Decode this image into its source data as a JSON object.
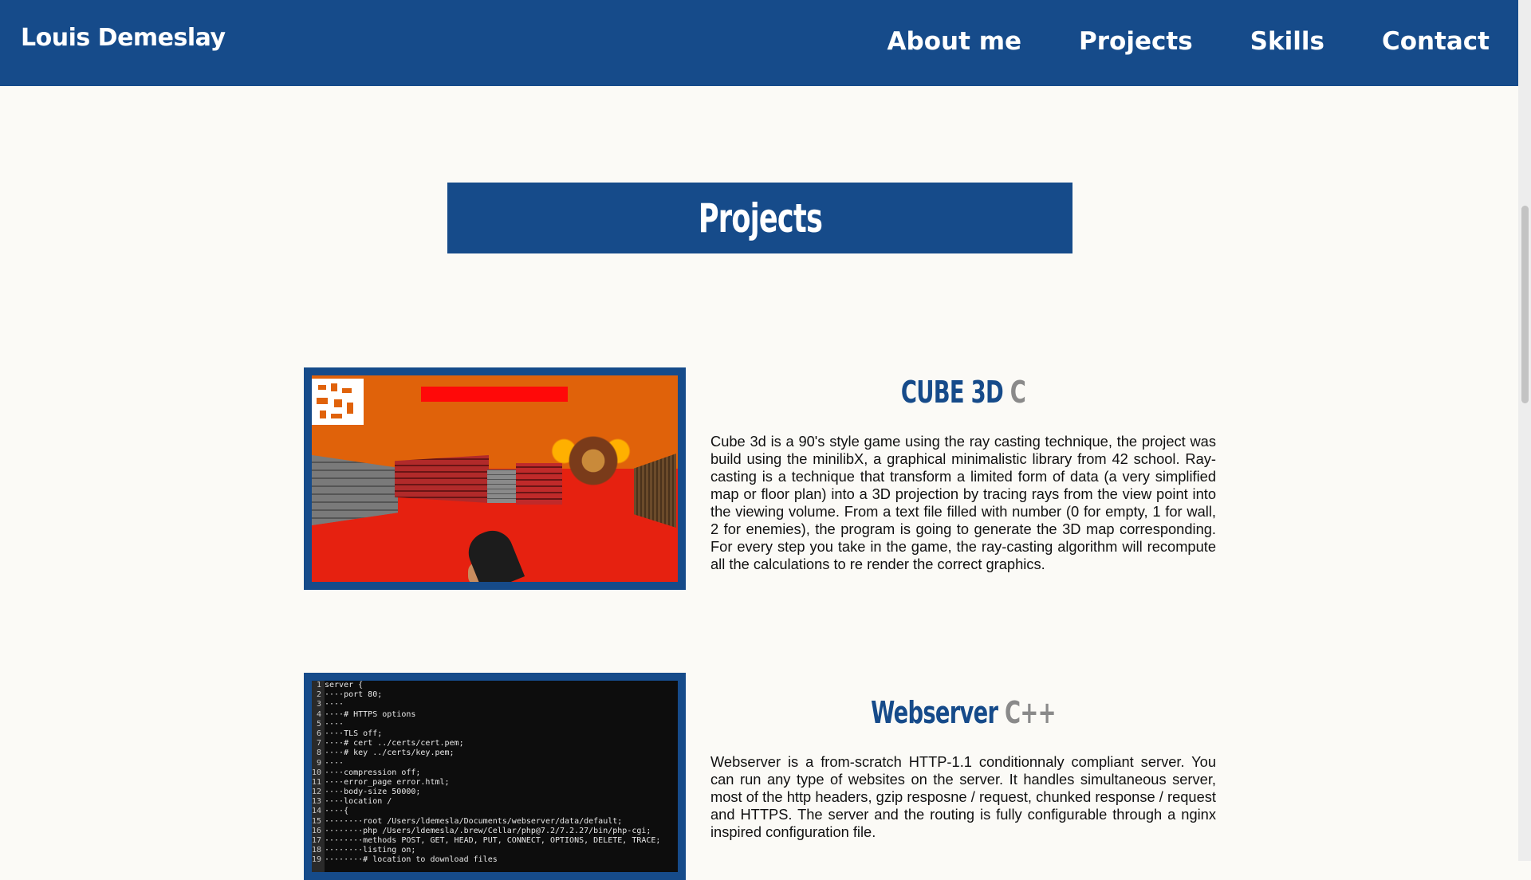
{
  "navbar": {
    "brand": "Louis Demeslay",
    "links": [
      "About me",
      "Projects",
      "Skills",
      "Contact"
    ]
  },
  "section": {
    "title": "Projects"
  },
  "projects": [
    {
      "name": "CUBE 3D",
      "lang": "C",
      "description": "Cube 3d is a 90's style game using the ray casting technique, the project was build using the minilibX, a graphical minimalistic library from 42 school. Ray-casting is a technique that transform a limited form of data (a very simplified map or floor plan) into a 3D projection by tracing rays from the view point into the viewing volume. From a text file filled with number (0 for empty, 1 for wall, 2 for enemies), the program is going to generate the 3D map corresponding. For every step you take in the game, the ray-casting algorithm will recompute all the calculations to re render the correct graphics."
    },
    {
      "name": "Webserver",
      "lang": "C++",
      "description": "Webserver is a from-scratch HTTP-1.1 conditionnaly compliant server. You can run any type of websites on the server. It handles simultaneous server, most of the http headers, gzip resposne / request, chunked response / request and HTTPS. The server and the routing is fully configurable through a nginx inspired configuration file."
    }
  ],
  "code_lines": [
    "server {",
    "····port 80;",
    "····",
    "····# HTTPS options",
    "····",
    "····TLS off;",
    "····# cert ../certs/cert.pem;",
    "····# key ../certs/key.pem;",
    "····",
    "····compression off;",
    "····error_page error.html;",
    "····body-size 50000;",
    "····location /",
    "····{",
    "········root /Users/ldemesla/Documents/webserver/data/default;",
    "········php /Users/ldemesla/.brew/Cellar/php@7.2/7.2.27/bin/php-cgi;",
    "········methods POST, GET, HEAD, PUT, CONNECT, OPTIONS, DELETE, TRACE;",
    "········listing on;",
    "········# location to download files"
  ],
  "colors": {
    "primary": "#164b8a",
    "accent_gray": "#8a8a8a",
    "background": "#fbfaf6"
  }
}
